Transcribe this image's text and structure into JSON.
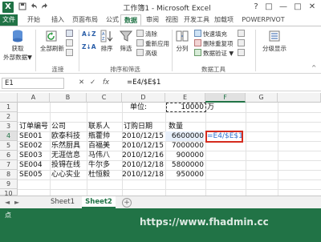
{
  "app": {
    "icon_letter": "X",
    "title": "工作簿1 - Microsoft Excel"
  },
  "quick_access": [
    "save-icon",
    "undo-icon",
    "redo-icon"
  ],
  "window_controls": [
    "?",
    "□",
    "—",
    "□",
    "✕"
  ],
  "tabs": [
    "文件",
    "开始",
    "插入",
    "页面布局",
    "公式",
    "数据",
    "审阅",
    "视图",
    "开发工具",
    "加载项",
    "POWERPIVOT"
  ],
  "active_tab": "数据",
  "ribbon": {
    "get_external": {
      "line1": "获取",
      "line2": "外部数据▼"
    },
    "refresh_all": {
      "line1": "全部刷新",
      "line2": ""
    },
    "connections_group": "连接",
    "sort_az": "A↓Z",
    "sort_za": "Z↓A",
    "sort": "排序",
    "filter": "筛选",
    "clear": "清除",
    "reapply": "重新应用",
    "advanced": "高级",
    "sort_filter_group": "排序和筛选",
    "text_to_columns": "分列",
    "flash_fill": "快速填充",
    "remove_duplicates": "删除重复项",
    "data_validation": "数据验证 ▼",
    "data_tools_group": "数据工具",
    "outline": "分级显示",
    "collapse_glyph": "^"
  },
  "formula_bar": {
    "name_box": "E1",
    "cancel": "✕",
    "enter": "✓",
    "fx": "fx",
    "formula": "=E4/$E$1"
  },
  "columns": [
    "A",
    "B",
    "C",
    "D",
    "E",
    "F",
    "G"
  ],
  "rows": [
    "1",
    "2",
    "3",
    "4",
    "5",
    "6",
    "7",
    "8",
    "9",
    "10"
  ],
  "cells": {
    "d1": "单位:",
    "e1": "10000",
    "f1": "万",
    "headers": [
      "订单编号",
      "公司",
      "联系人",
      "订购日期",
      "数量"
    ],
    "records": [
      [
        "SE001",
        "欧泰科技",
        "瓶藿帅",
        "2010/12/15",
        "6600000"
      ],
      [
        "SE002",
        "乐然厨具",
        "百福美",
        "2010/12/15",
        "7000000"
      ],
      [
        "SE003",
        "无涯信息",
        "马伟八",
        "2010/12/16",
        "900000"
      ],
      [
        "SE004",
        "投锝在线",
        "牛尔多",
        "2010/12/18",
        "5800000"
      ],
      [
        "SE005",
        "心心实业",
        "杜恒毅",
        "2010/12/18",
        "950000"
      ]
    ],
    "f4": "=E4/$E$1"
  },
  "sheets": [
    "Sheet1",
    "Sheet2"
  ],
  "active_sheet": "Sheet2",
  "sheet_nav": [
    "◄",
    "►"
  ],
  "add_sheet": "+",
  "status": "点",
  "watermark": "https://www.fhadmin.cc",
  "colors": {
    "excel_green": "#217346",
    "selection_red": "#d52b1e",
    "formula_blue": "#2d6fd0"
  }
}
